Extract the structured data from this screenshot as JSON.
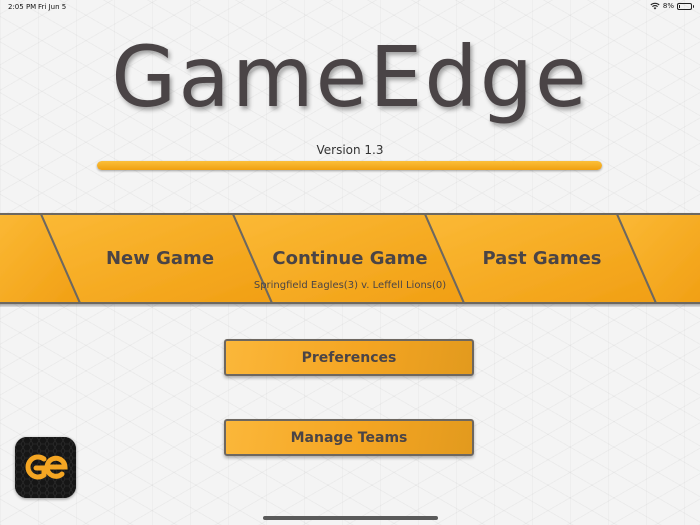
{
  "status_bar": {
    "time": "2:05 PM",
    "date": "Fri Jun 5",
    "battery_text": "8%",
    "battery_level": 0.08
  },
  "app": {
    "title": "GameEdge",
    "version": "Version 1.3",
    "progress": 1.0
  },
  "main_menu": {
    "new_game": "New Game",
    "continue_game": "Continue Game",
    "continue_subtitle": "Springfield Eagles(3) v. Leffell Lions(0)",
    "past_games": "Past Games"
  },
  "buttons": {
    "preferences": "Preferences",
    "manage_teams": "Manage Teams"
  },
  "colors": {
    "accent": "#f5a623",
    "title_text": "#4a4446",
    "logo_bg": "#161616"
  },
  "icons": {
    "wifi": "wifi-icon",
    "battery": "battery-icon",
    "logo": "gameedge-logo"
  }
}
